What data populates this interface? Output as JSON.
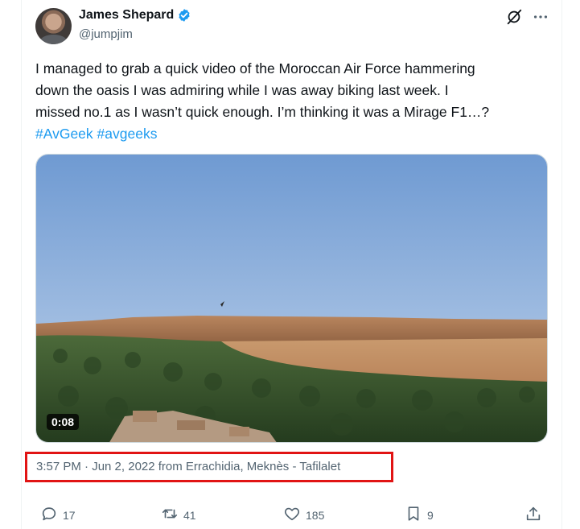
{
  "tweet": {
    "author": {
      "display_name": "James Shepard",
      "handle": "@jumpjim",
      "verified": true,
      "avatar": "profile-photo"
    },
    "text": {
      "line1": "I managed to grab a quick video of the Moroccan Air Force hammering",
      "line2": "down the oasis I was admiring while I was away biking last week. I",
      "line3": "missed no.1 as I wasn’t quick enough. I’m thinking it was a Mirage F1…?",
      "hashtags": [
        "#AvGeek",
        "#avgeeks"
      ]
    },
    "media": {
      "type": "video",
      "duration": "0:08"
    },
    "meta": {
      "text": "3:57 PM · Jun 2, 2022 from Errachidia, Meknès - Tafilalet",
      "highlight_color": "#e11414"
    },
    "actions": {
      "replies": "17",
      "reposts": "41",
      "likes": "185",
      "bookmarks": "9"
    }
  },
  "colors": {
    "accent": "#1d9bf0",
    "text_primary": "#0f1419",
    "text_secondary": "#536471"
  },
  "icons": {
    "header": [
      "grok-icon",
      "more-icon"
    ],
    "actions": [
      "reply-icon",
      "repost-icon",
      "like-icon",
      "bookmark-icon",
      "share-icon"
    ]
  }
}
